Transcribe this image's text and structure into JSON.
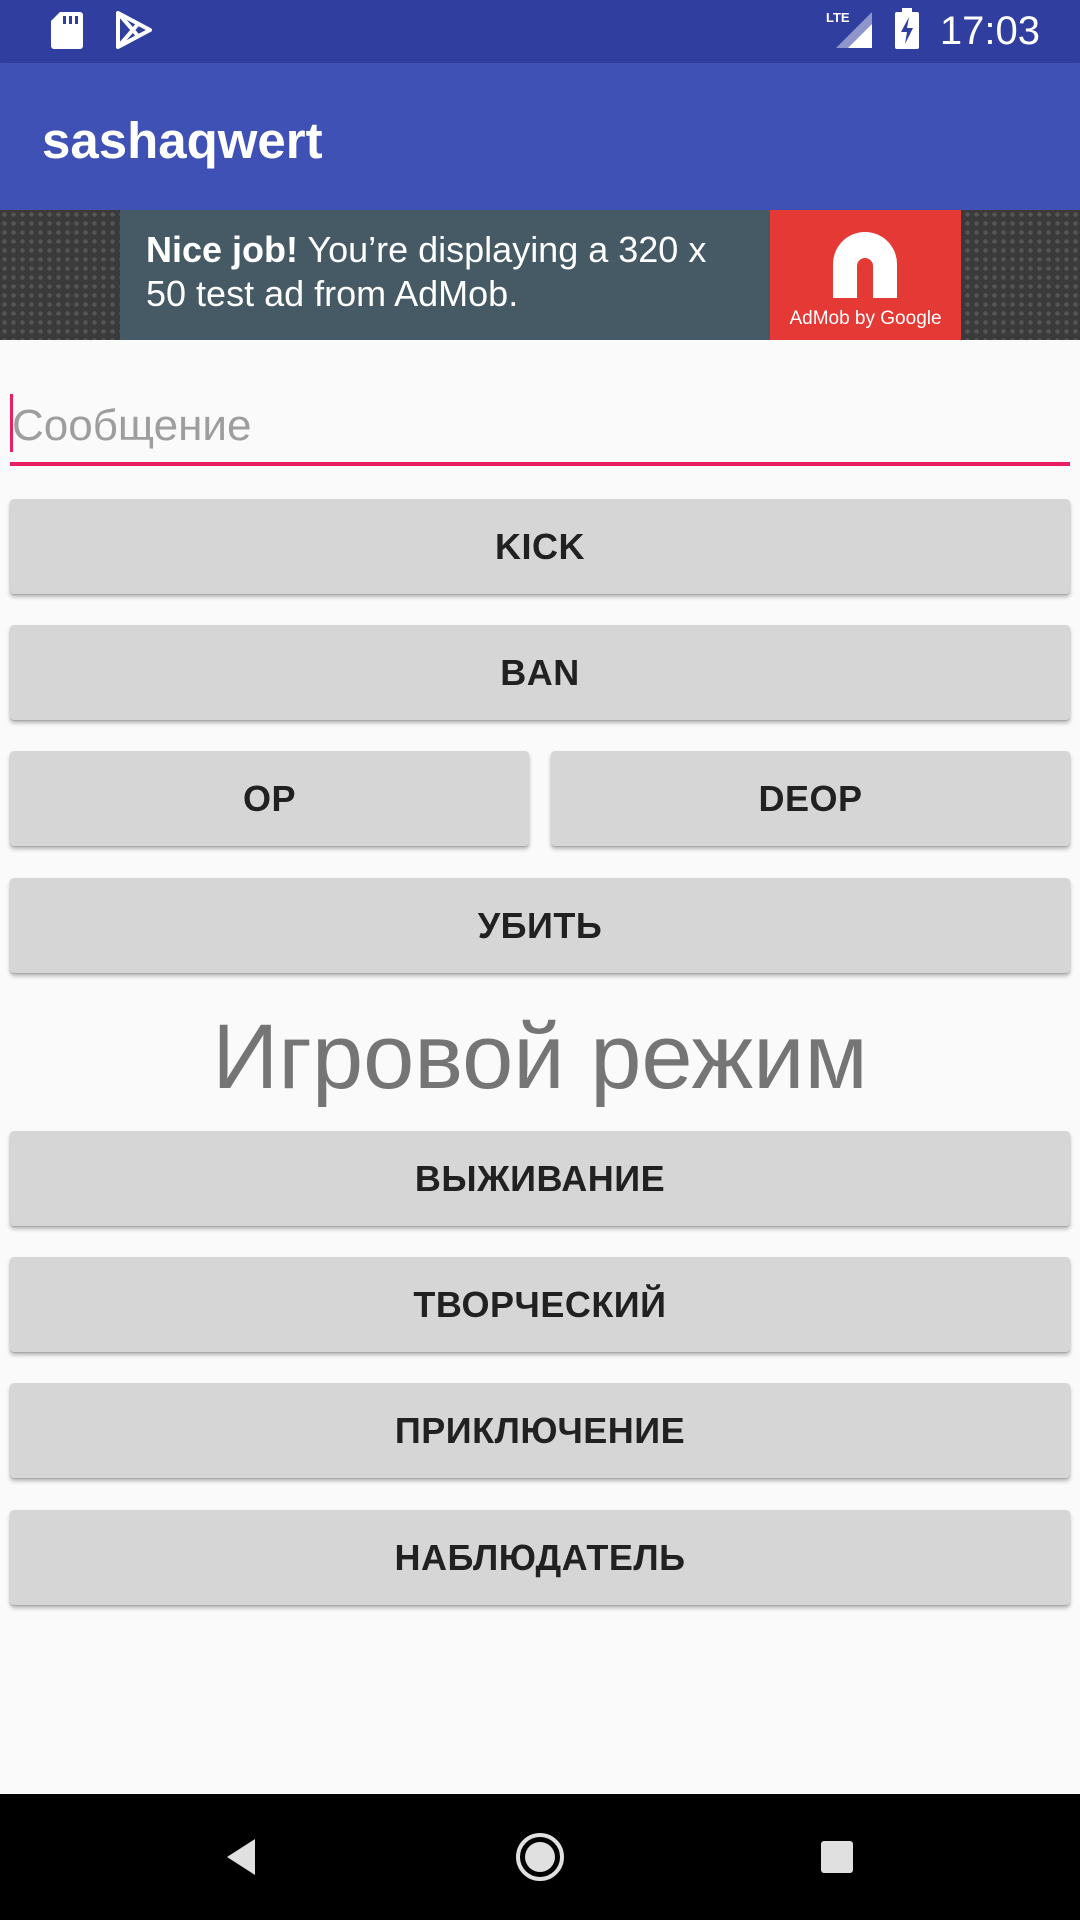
{
  "status_bar": {
    "time": "17:03",
    "left_icons": [
      "sd-card-icon",
      "play-store-icon"
    ],
    "right_icons": [
      "lte-signal-icon",
      "battery-charging-icon"
    ],
    "network_label": "LTE"
  },
  "app_bar": {
    "title": "sashaqwert",
    "color": "#3f51b5",
    "status_color": "#303f9f"
  },
  "ad": {
    "headline": "Nice job!",
    "body": " You’re displaying a 320 x 50 test ad from AdMob.",
    "brand": "AdMob by Google",
    "brand_color": "#e53935"
  },
  "message_input": {
    "placeholder": "Сообщение",
    "value": "",
    "accent_color": "#e91e63"
  },
  "buttons": {
    "kick": "KICK",
    "ban": "BAN",
    "op": "OP",
    "deop": "DEOP",
    "kill": "УБИТЬ"
  },
  "game_mode": {
    "heading": "Игровой режим",
    "survival": "ВЫЖИВАНИЕ",
    "creative": "ТВОРЧЕСКИЙ",
    "adventure": "ПРИКЛЮЧЕНИЕ",
    "spectator": "НАБЛЮДАТЕЛЬ"
  },
  "nav_bar": {
    "icons": [
      "back-icon",
      "home-icon",
      "recents-icon"
    ]
  }
}
